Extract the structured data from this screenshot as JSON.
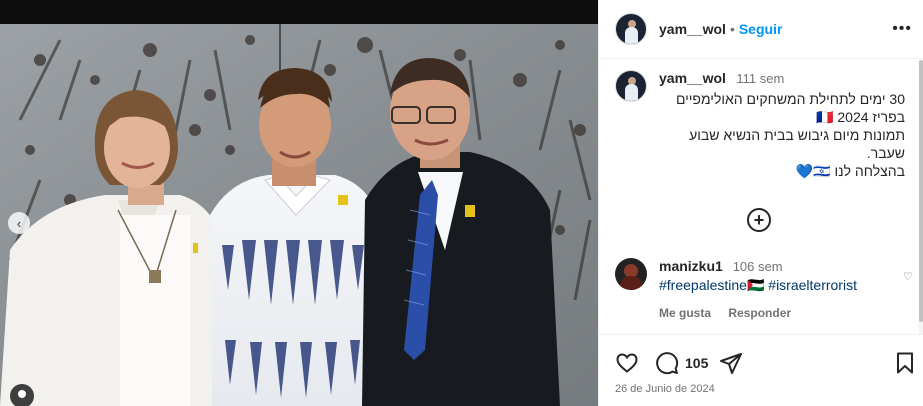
{
  "post": {
    "username": "yam__wol",
    "follow_label": "Seguir",
    "separator": "•",
    "more_label": "•••"
  },
  "caption": {
    "username": "yam__wol",
    "time": "111 sem",
    "text": "30 ימים לתחילת המשחקים האולימפיים\nבפריז 2024 🇫🇷\nתמונות מיום גיבוש בבית הנשיא שבוע\nשעבר.\nבהצלחה לנו 🇮🇱💙"
  },
  "load_more_label": "+",
  "comment": {
    "username": "manizku1",
    "time": "106 sem",
    "tag1": "#freepalestine🇵🇸",
    "tag2": "#israelterrorist",
    "like_label": "Me gusta",
    "reply_label": "Responder",
    "heart": "♡"
  },
  "actions": {
    "comment_count": "105",
    "date": "26 de Junio de 2024",
    "nav_prev": "‹"
  },
  "icons": [
    "heart-icon",
    "comment-icon",
    "share-icon",
    "bookmark-icon",
    "add-circle-icon",
    "more-icon",
    "prev-arrow-icon"
  ],
  "colors": {
    "accent": "#0095f6",
    "hashtag": "#00376b",
    "muted": "#737373"
  }
}
